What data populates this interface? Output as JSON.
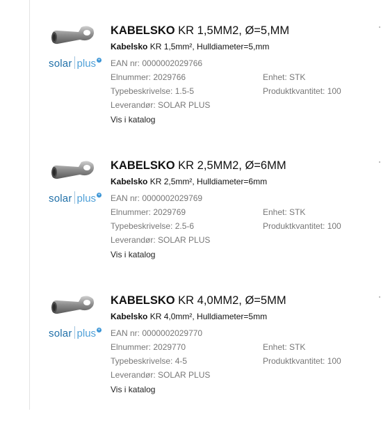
{
  "products": [
    {
      "title_strong": "KABELSKO",
      "title_rest": " KR 1,5MM2, Ø=5,MM",
      "subtitle_strong": "Kabelsko",
      "subtitle_rest": " KR 1,5mm², Hulldiameter=5,mm",
      "ean": "EAN nr: 0000002029766",
      "elnummer": "Elnummer: 2029766",
      "typebeskrivelse": "Typebeskrivelse: 1.5-5",
      "leverandor": "Leverandør: SOLAR PLUS",
      "enhet": "Enhet: STK",
      "produktkvantitet": "Produktkvantitet: 100",
      "link": "Vis i katalog"
    },
    {
      "title_strong": "KABELSKO",
      "title_rest": " KR 2,5MM2, Ø=6MM",
      "subtitle_strong": "Kabelsko",
      "subtitle_rest": " KR 2,5mm², Hulldiameter=6mm",
      "ean": "EAN nr: 0000002029769",
      "elnummer": "Elnummer: 2029769",
      "typebeskrivelse": "Typebeskrivelse: 2.5-6",
      "leverandor": "Leverandør: SOLAR PLUS",
      "enhet": "Enhet: STK",
      "produktkvantitet": "Produktkvantitet: 100",
      "link": "Vis i katalog"
    },
    {
      "title_strong": "KABELSKO",
      "title_rest": " KR 4,0MM2, Ø=5MM",
      "subtitle_strong": "Kabelsko",
      "subtitle_rest": " KR 4,0mm², Hulldiameter=5mm",
      "ean": "EAN nr: 0000002029770",
      "elnummer": "Elnummer: 2029770",
      "typebeskrivelse": "Typebeskrivelse: 4-5",
      "leverandor": "Leverandør: SOLAR PLUS",
      "enhet": "Enhet: STK",
      "produktkvantitet": "Produktkvantitet: 100",
      "link": "Vis i katalog"
    }
  ],
  "brand": {
    "logo_text_solar": "solar",
    "logo_text_plus": "plus",
    "logo_badge": "+",
    "logo_color": "#1f6fa8",
    "accent_color": "#4fa0d8"
  }
}
